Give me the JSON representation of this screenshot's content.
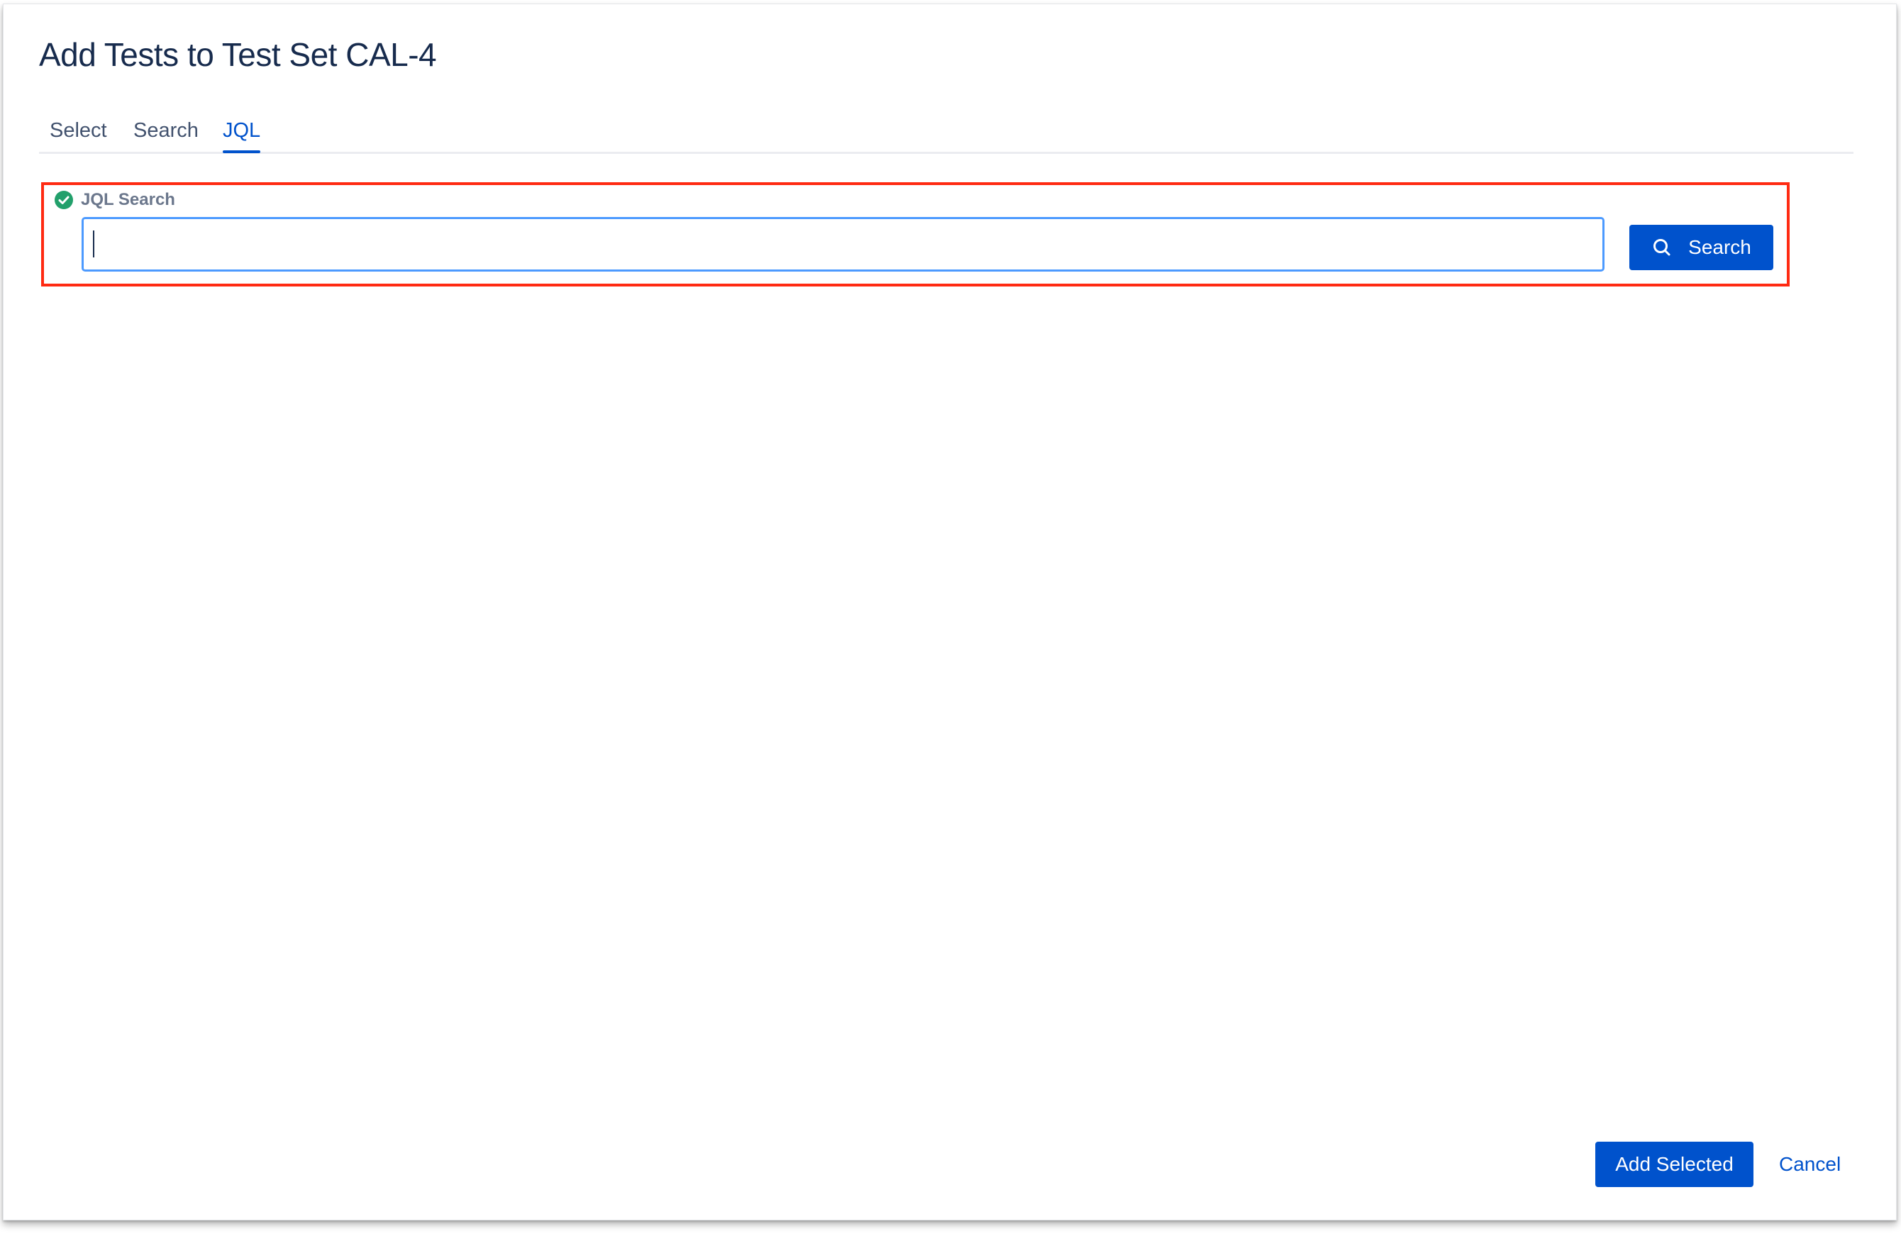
{
  "dialog": {
    "title": "Add Tests to Test Set CAL-4"
  },
  "tabs": [
    {
      "label": "Select",
      "active": false
    },
    {
      "label": "Search",
      "active": false
    },
    {
      "label": "JQL",
      "active": true
    }
  ],
  "jql": {
    "label": "JQL Search",
    "status_icon": "check-circle-icon",
    "status_color": "#22a06b",
    "value": "",
    "placeholder": "",
    "search_button_label": "Search",
    "search_button_icon": "search-icon"
  },
  "footer": {
    "add_selected_label": "Add Selected",
    "cancel_label": "Cancel"
  },
  "colors": {
    "primary": "#0052cc",
    "title_text": "#172b4d",
    "focus_border": "#4c9aff",
    "annotation_box": "#ff2a12"
  }
}
